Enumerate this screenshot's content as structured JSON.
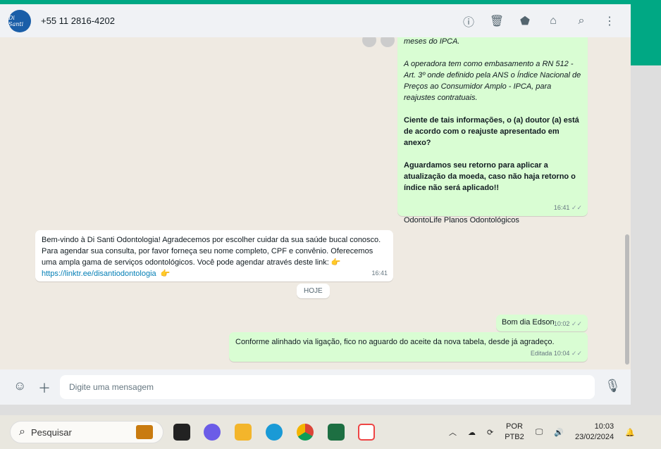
{
  "header": {
    "avatar_text": "Di Santi",
    "phone": "+55 11 2816-4202",
    "icons": [
      "info-icon",
      "trash-icon",
      "label-icon",
      "store-icon",
      "search-icon",
      "menu-icon"
    ]
  },
  "messages": [
    {
      "type": "out",
      "lines_italic": [
        "meses do IPCA.",
        "A operadora tem como embasamento a RN 512 - Art. 3º onde definido pela ANS o Índice Nacional de Preços ao Consumidor Amplo - IPCA, para reajustes contratuais."
      ],
      "bold1": "Ciente de tais informações, o (a) doutor (a) está de acordo com o reajuste apresentado em anexo?",
      "bold2": "Aguardamos seu retorno para aplicar a atualização da moeda, caso não haja retorno o índice não será aplicado!!",
      "signature": "OdontoLife Planos Odontológicos",
      "time": "16:41"
    },
    {
      "type": "in",
      "text": "Bem-vindo à Di Santi Odontologia! Agradecemos por escolher cuidar da sua saúde bucal conosco. Para agendar sua consulta, por favor forneça seu nome completo, CPF e convênio. Oferecemos uma ampla gama de serviços odontológicos. Você pode agendar através deste link: 👉",
      "link": "https://linktr.ee/disantiodontologia",
      "emoji": "👉",
      "time": "16:41"
    },
    {
      "type": "date",
      "text": "HOJE"
    },
    {
      "type": "out",
      "text": "Bom dia Edson",
      "time": "10:02"
    },
    {
      "type": "out",
      "text": "Conforme alinhado via ligação, fico no aguardo do aceite da nova tabela, desde já agradeço.",
      "edited": "Editada",
      "time": "10:04"
    }
  ],
  "input": {
    "placeholder": "Digite uma mensagem"
  },
  "taskbar": {
    "search_placeholder": "Pesquisar",
    "lang1": "POR",
    "lang2": "PTB2",
    "time": "10:03",
    "date": "23/02/2024"
  }
}
